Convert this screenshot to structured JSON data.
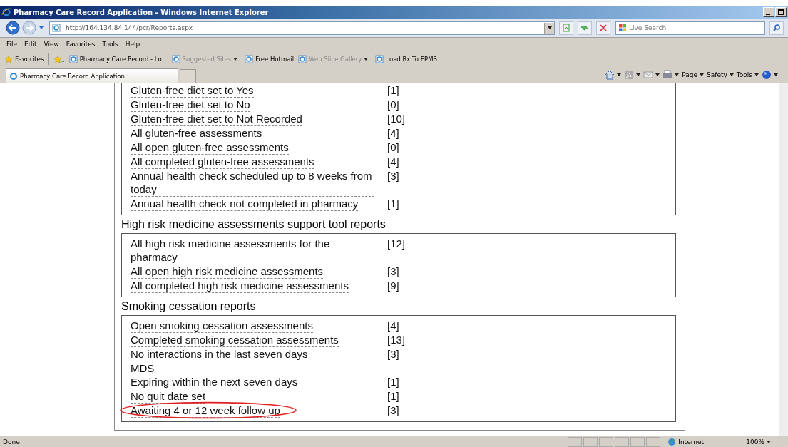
{
  "window": {
    "title": "Pharmacy Care Record Application - Windows Internet Explorer"
  },
  "address_bar": {
    "url": "http://164.134.84.144/pcr/Reports.aspx"
  },
  "search": {
    "placeholder": "Live Search"
  },
  "menu": [
    "File",
    "Edit",
    "View",
    "Favorites",
    "Tools",
    "Help"
  ],
  "favorites_bar": {
    "label": "Favorites",
    "links": [
      {
        "label": "Pharmacy Care Record - Lo...",
        "disabled": false,
        "dropdown": false
      },
      {
        "label": "Suggested Sites",
        "disabled": true,
        "dropdown": true
      },
      {
        "label": "Free Hotmail",
        "disabled": false,
        "dropdown": false
      },
      {
        "label": "Web Slice Gallery",
        "disabled": true,
        "dropdown": true
      },
      {
        "label": "Load Rx To EPMS",
        "disabled": false,
        "dropdown": false
      }
    ]
  },
  "tabs": [
    {
      "label": "Pharmacy Care Record Application",
      "selected": true
    }
  ],
  "command_bar": [
    "Page",
    "Safety",
    "Tools"
  ],
  "sections": [
    {
      "items": [
        {
          "kind": "link",
          "label": "Gluten-free diet set to Yes",
          "count": "[1]",
          "circled": false
        },
        {
          "kind": "link",
          "label": "Gluten-free diet set to No",
          "count": "[0]",
          "circled": false
        },
        {
          "kind": "link",
          "label": "Gluten-free diet set to Not Recorded",
          "count": "[10]",
          "circled": false
        },
        {
          "kind": "link",
          "label": "All gluten-free assessments",
          "count": "[4]",
          "circled": false
        },
        {
          "kind": "link",
          "label": "All open gluten-free assessments",
          "count": "[0]",
          "circled": false
        },
        {
          "kind": "link",
          "label": "All completed gluten-free assessments",
          "count": "[4]",
          "circled": false
        },
        {
          "kind": "link",
          "label": "Annual health check scheduled up to 8 weeks from today",
          "count": "[3]",
          "circled": false
        },
        {
          "kind": "link",
          "label": "Annual health check not completed in pharmacy",
          "count": "[1]",
          "circled": false
        }
      ]
    },
    {
      "heading": "High risk medicine assessments support tool reports",
      "items": [
        {
          "kind": "link",
          "label": "All high risk medicine assessments for the pharmacy",
          "count": "[12]",
          "circled": false
        },
        {
          "kind": "link",
          "label": "All open high risk medicine assessments",
          "count": "[3]",
          "circled": false
        },
        {
          "kind": "link",
          "label": "All completed high risk medicine assessments",
          "count": "[9]",
          "circled": false
        }
      ]
    },
    {
      "heading": "Smoking cessation reports",
      "items": [
        {
          "kind": "link",
          "label": "Open smoking cessation assessments",
          "count": "[4]",
          "circled": false
        },
        {
          "kind": "link",
          "label": "Completed smoking cessation assessments",
          "count": "[13]",
          "circled": false
        },
        {
          "kind": "link",
          "label": "No interactions in the last seven days",
          "count": "[3]",
          "circled": false
        },
        {
          "kind": "subheading",
          "label": "MDS"
        },
        {
          "kind": "link",
          "label": "Expiring within the next seven days",
          "count": "[1]",
          "circled": false
        },
        {
          "kind": "link",
          "label": "No quit date set",
          "count": "[1]",
          "circled": false
        },
        {
          "kind": "link",
          "label": "Awaiting 4 or 12 week follow up",
          "count": "[3]",
          "circled": true
        }
      ]
    }
  ],
  "status_bar": {
    "text": "Done",
    "zone": "Internet",
    "zoom": "100%"
  }
}
